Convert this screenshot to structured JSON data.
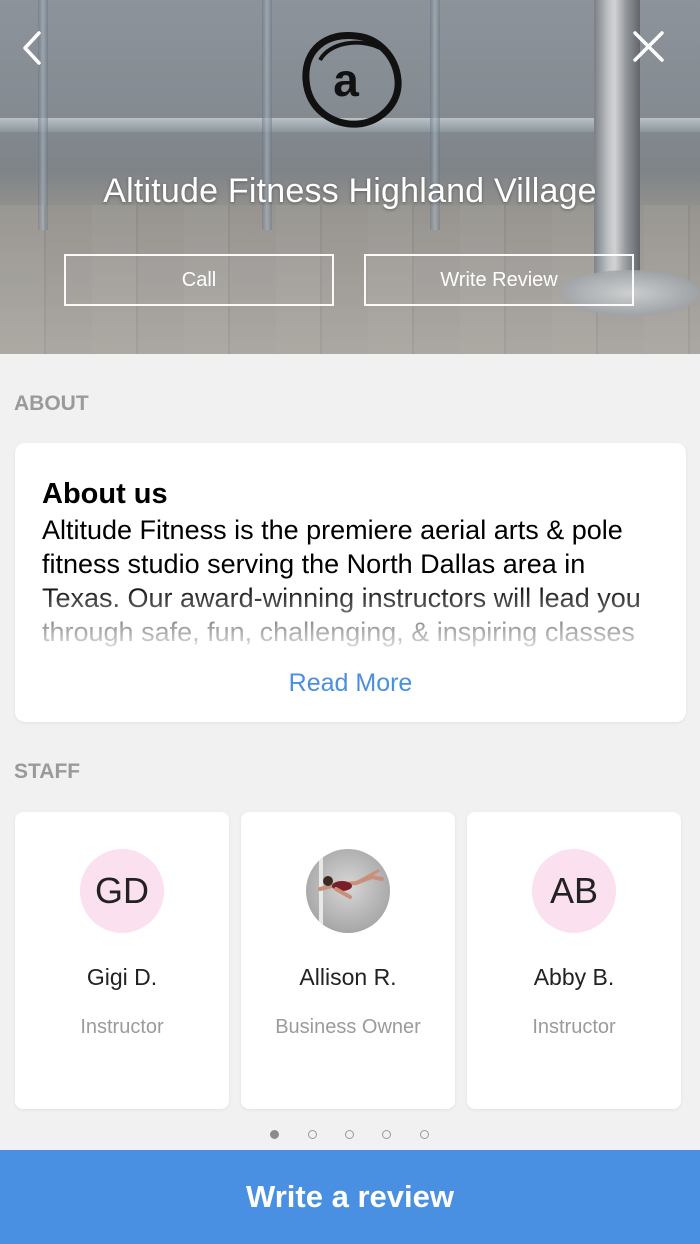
{
  "header": {
    "studio_name": "Altitude Fitness Highland Village",
    "logo_letter": "a",
    "call_label": "Call",
    "write_review_label": "Write Review",
    "back_icon": "chevron-left-icon",
    "close_icon": "close-icon"
  },
  "about": {
    "section_label": "ABOUT",
    "title": "About us",
    "body": "Altitude Fitness is the premiere aerial arts & pole fitness studio serving the North Dallas area in Texas. Our award-winning instructors will lead you through safe, fun, challenging, & inspiring classes",
    "read_more": "Read More"
  },
  "staff": {
    "section_label": "STAFF",
    "members": [
      {
        "initials": "GD",
        "name": "Gigi D.",
        "role": "Instructor"
      },
      {
        "initials": "",
        "name": "Allison R.",
        "role": "Business Owner"
      },
      {
        "initials": "AB",
        "name": "Abby B.",
        "role": "Instructor"
      }
    ],
    "page_count": 5,
    "active_page": 1
  },
  "footer": {
    "write_review_button": "Write a review"
  },
  "colors": {
    "accent": "#4a90e2",
    "avatar_bg": "#fbe0ef",
    "background": "#f1f1f1"
  }
}
